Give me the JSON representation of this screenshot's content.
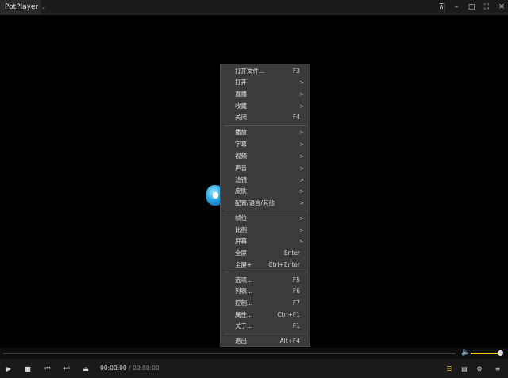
{
  "app": {
    "title": "PotPlayer"
  },
  "window_controls": [
    {
      "name": "pin-icon",
      "glyph": "⊼"
    },
    {
      "name": "minimize-icon",
      "glyph": "–"
    },
    {
      "name": "maximize-icon",
      "glyph": "□"
    },
    {
      "name": "fullscreen-icon",
      "glyph": "⛶"
    },
    {
      "name": "close-icon",
      "glyph": "✕"
    }
  ],
  "menu": {
    "items": [
      {
        "label": "打开文件...",
        "shortcut": "F3"
      },
      {
        "label": "打开",
        "arrow": ">"
      },
      {
        "label": "直播",
        "arrow": ">"
      },
      {
        "label": "收藏",
        "arrow": ">"
      },
      {
        "label": "关闭",
        "shortcut": "F4"
      },
      {
        "label": "播放",
        "arrow": ">"
      },
      {
        "label": "字幕",
        "arrow": ">"
      },
      {
        "label": "视频",
        "arrow": ">"
      },
      {
        "label": "声音",
        "arrow": ">"
      },
      {
        "label": "滤镜",
        "arrow": ">"
      },
      {
        "label": "皮肤",
        "arrow": ">"
      },
      {
        "label": "配置/语言/其他",
        "arrow": ">"
      },
      {
        "label": "帧位",
        "arrow": ">"
      },
      {
        "label": "比例",
        "arrow": ">"
      },
      {
        "label": "屏幕",
        "arrow": ">"
      },
      {
        "label": "全屏",
        "shortcut": "Enter"
      },
      {
        "label": "全屏+",
        "shortcut": "Ctrl+Enter"
      },
      {
        "label": "选项...",
        "shortcut": "F5"
      },
      {
        "label": "列表...",
        "shortcut": "F6"
      },
      {
        "label": "控制...",
        "shortcut": "F7"
      },
      {
        "label": "属性...",
        "shortcut": "Ctrl+F1"
      },
      {
        "label": "关于...",
        "shortcut": "F1"
      },
      {
        "label": "退出",
        "shortcut": "Alt+F4"
      }
    ]
  },
  "player": {
    "current_time": "00:00:00",
    "separator": "/",
    "duration": "00:00:00",
    "volume_fraction": 0.9,
    "accent_color": "#e8c800"
  },
  "control_buttons": {
    "play": "▶",
    "stop": "■",
    "prev": "⏮",
    "next": "⏭",
    "eject": "⏏",
    "playlist": "☰",
    "chapters": "▤",
    "settings": "⚙",
    "menu": "≡"
  }
}
